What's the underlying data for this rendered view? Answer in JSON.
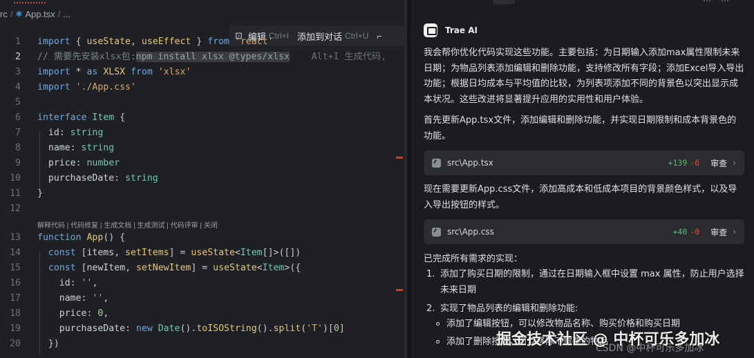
{
  "editor": {
    "breadcrumb": [
      "rc",
      "App.tsx",
      "..."
    ],
    "inline_menu": {
      "edit": "编辑",
      "edit_shortcut": "Ctrl+I",
      "add_to_chat": "添加到对话",
      "add_to_chat_shortcut": "Ctrl+U"
    },
    "codelens": "解释代码 | 代码修复 | 生成文档 | 生成测试 | 代码评审 | 关闭",
    "ghost_hint": "Alt+I 生成代码,",
    "line_numbers": [
      "1",
      "2",
      "3",
      "4",
      "5",
      "6",
      "7",
      "8",
      "9",
      "10",
      "11",
      "12",
      "13",
      "14",
      "15",
      "16",
      "17",
      "18",
      "19",
      "20"
    ]
  },
  "chat": {
    "assistant_name": "Trae AI",
    "intro": "我会帮你优化代码实现这些功能。主要包括：为日期输入添加max属性限制未来日期；为物品列表添加编辑和删除功能，支持修改所有字段；添加Excel导入导出功能；根据日均成本与平均值的比较，为列表项添加不同的背景色以突出显示成本状况。这些改进将显著提升应用的实用性和用户体验。",
    "step1": "首先更新App.tsx文件，添加编辑和删除功能，并实现日期限制和成本背景色的功能。",
    "files": [
      {
        "name": "src\\App.tsx",
        "added": "+139",
        "removed": "-6",
        "action": "审查"
      },
      {
        "name": "src\\App.css",
        "added": "+40",
        "removed": "-0",
        "action": "审查"
      }
    ],
    "step2": "现在需要更新App.css文件，添加高成本和低成本项目的背景颜色样式，以及导入导出按钮的样式。",
    "done": "已完成所有需求的实现：",
    "items": [
      {
        "n": "1.",
        "text": "添加了购买日期的限制，通过在日期输入框中设置 max 属性，防止用户选择未来日期"
      },
      {
        "n": "2.",
        "text": "实现了物品列表的编辑和删除功能:"
      }
    ],
    "subitems": [
      "添加了编辑按钮，可以修改物品名称、购买价格和购买日期",
      "添加了删除按钮，可以移除不需要的物品"
    ]
  },
  "watermark": "掘金技术社区 @ 中杯可乐多加冰",
  "watermark_small": "CSDN @中杯可乐多加冰"
}
